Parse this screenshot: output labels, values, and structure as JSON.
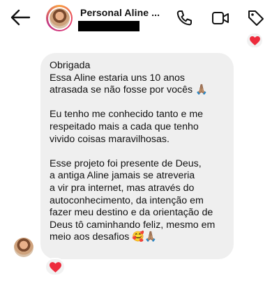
{
  "header": {
    "contact_name": "Personal Aline ..."
  },
  "message": {
    "text": "Obrigada\nEssa Aline estaria uns 10 anos\natrasada se não fosse por vocês 🙏🏽\n\nEu tenho me conhecido tanto e me\nrespeitado mais a cada que tenho\nvivido coisas maravilhosas.\n\nEsse projeto foi presente de Deus,\na antiga Aline jamais se atreveria\na vir pra internet, mas através do\nautoconhecimento, da intenção em\nfazer meu destino e da orientação de\nDeus tô caminhando feliz, mesmo em\nmeio aos desafios 🥰🙏🏽"
  },
  "colors": {
    "bubble": "#efefef",
    "heart": "#ed2b3c",
    "icon": "#111111"
  },
  "icons": [
    "back-arrow-icon",
    "phone-icon",
    "video-camera-icon",
    "tag-icon",
    "heart-icon"
  ]
}
